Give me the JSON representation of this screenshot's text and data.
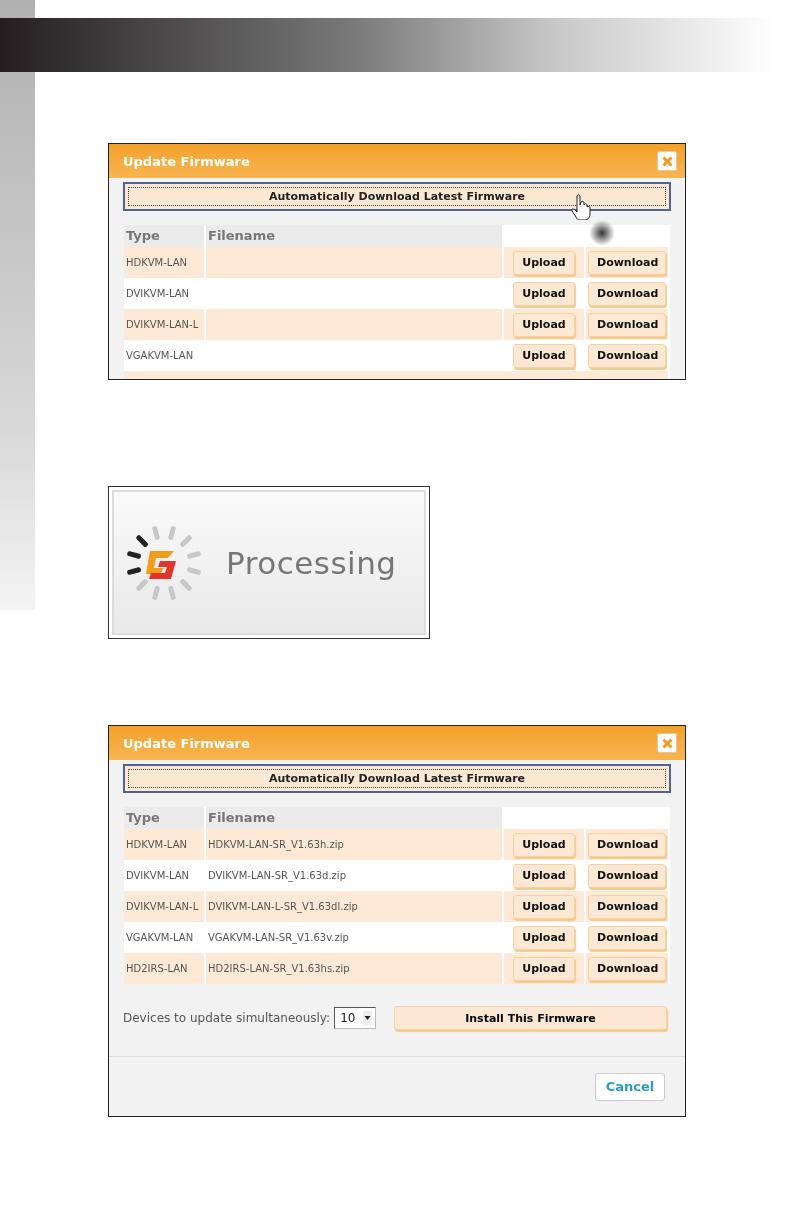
{
  "dialogs": [
    {
      "title": "Update Firmware",
      "auto_download": {
        "label": "Automatically Download Latest Firmware",
        "hovered": true
      },
      "columns": [
        "Type",
        "Filename"
      ],
      "truncated": true,
      "rows": [
        {
          "type": "HDKVM-LAN",
          "upload": "Upload",
          "download": "Download"
        },
        {
          "type": "DVIKVM-LAN",
          "upload": "Upload",
          "download": "Download"
        },
        {
          "type": "DVIKVM-LAN-L",
          "upload": "Upload",
          "download": "Download"
        },
        {
          "type": "VGAKVM-LAN",
          "upload": "Upload",
          "download": "Download"
        }
      ]
    },
    {
      "title": "Update Firmware",
      "auto_download": {
        "label": "Automatically Download Latest Firmware",
        "hovered": false
      },
      "columns": [
        "Type",
        "Filename"
      ],
      "truncated": false,
      "rows": [
        {
          "type": "HDKVM-LAN",
          "filename": "HDKVM-LAN-SR_V1.63h.zip",
          "upload": "Upload",
          "download": "Download"
        },
        {
          "type": "DVIKVM-LAN",
          "filename": "DVIKVM-LAN-SR_V1.63d.zip",
          "upload": "Upload",
          "download": "Download"
        },
        {
          "type": "DVIKVM-LAN-L",
          "filename": "DVIKVM-LAN-L-SR_V1.63dl.zip",
          "upload": "Upload",
          "download": "Download"
        },
        {
          "type": "VGAKVM-LAN",
          "filename": "VGAKVM-LAN-SR_V1.63v.zip",
          "upload": "Upload",
          "download": "Download"
        },
        {
          "type": "HD2IRS-LAN",
          "filename": "HD2IRS-LAN-SR_V1.63hs.zip",
          "upload": "Upload",
          "download": "Download"
        }
      ],
      "simultaneous": {
        "label": "Devices to update simultaneously:",
        "value": "10"
      },
      "install_button": "Install This Firmware",
      "cancel_button": "Cancel"
    }
  ],
  "processing": {
    "label": "Processing"
  }
}
